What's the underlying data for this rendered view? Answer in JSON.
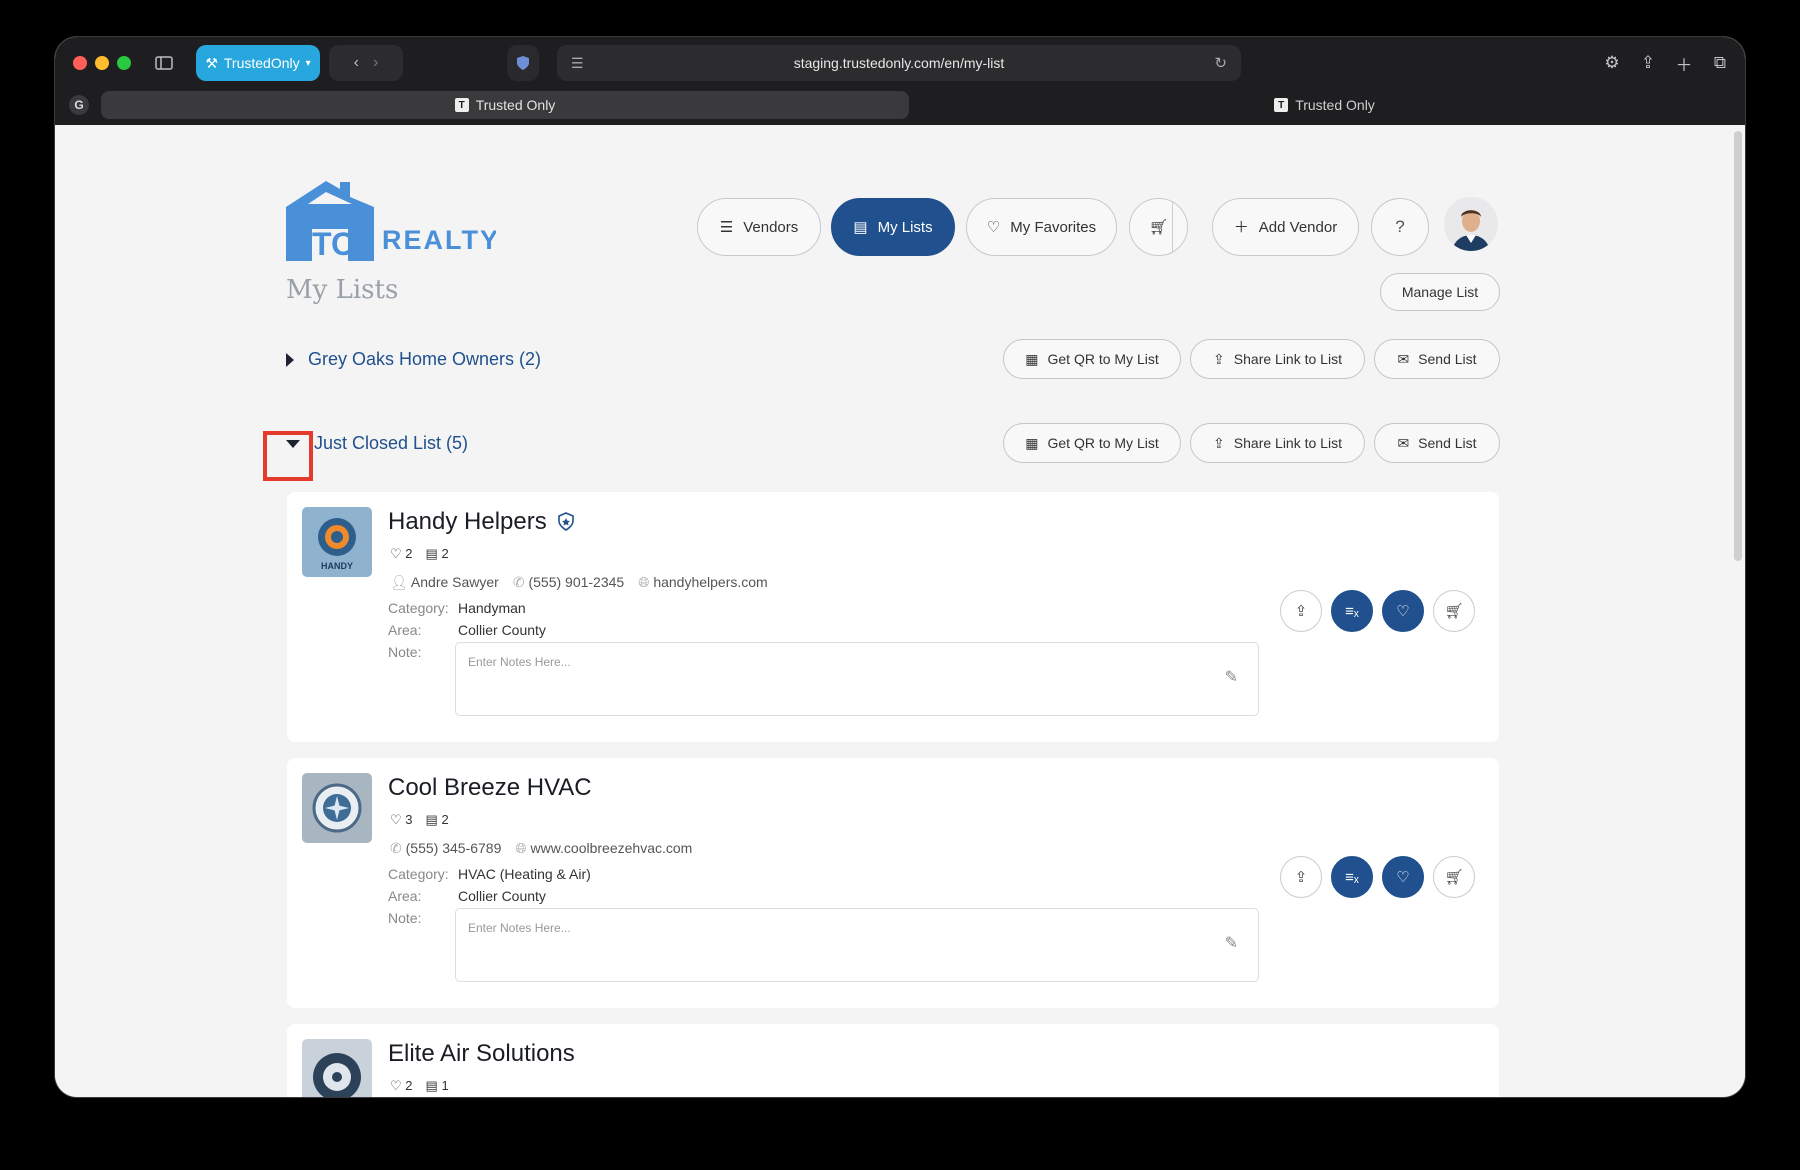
{
  "browser": {
    "profile": "TrustedOnly",
    "url": "staging.trustedonly.com/en/my-list",
    "tabs": [
      {
        "title": "Trusted Only",
        "active": true
      },
      {
        "title": "Trusted Only",
        "active": false
      }
    ]
  },
  "logo": {
    "text_left": "TO",
    "text_right": "REALTY"
  },
  "nav": {
    "vendors": "Vendors",
    "my_lists": "My Lists",
    "my_favorites": "My Favorites",
    "add_vendor": "Add Vendor",
    "help": "?"
  },
  "page": {
    "title": "My Lists",
    "manage_list": "Manage List"
  },
  "list_actions": {
    "qr": "Get QR to My List",
    "share": "Share Link to List",
    "send": "Send List"
  },
  "lists": [
    {
      "title": "Grey Oaks Home Owners (2)",
      "expanded": false
    },
    {
      "title": "Just Closed List (5)",
      "expanded": true
    }
  ],
  "labels": {
    "category": "Category:",
    "area": "Area:",
    "note": "Note:",
    "note_placeholder": "Enter Notes Here..."
  },
  "vendors": [
    {
      "name": "Handy Helpers",
      "verified": true,
      "likes": "2",
      "lists": "2",
      "contact_name": "Andre Sawyer",
      "phone": "(555) 901-2345",
      "website": "handyhelpers.com",
      "category": "Handyman",
      "area": "Collier County",
      "logo_text": "HANDY"
    },
    {
      "name": "Cool Breeze HVAC",
      "verified": false,
      "likes": "3",
      "lists": "2",
      "phone": "(555) 345-6789",
      "website": "www.coolbreezehvac.com",
      "category": "HVAC (Heating & Air)",
      "area": "Collier County"
    },
    {
      "name": "Elite Air Solutions",
      "verified": false,
      "likes": "2",
      "lists": "1"
    }
  ],
  "colors": {
    "brand_blue": "#20508d",
    "logo_blue": "#4a90d9",
    "highlight": "#e53b2c"
  }
}
